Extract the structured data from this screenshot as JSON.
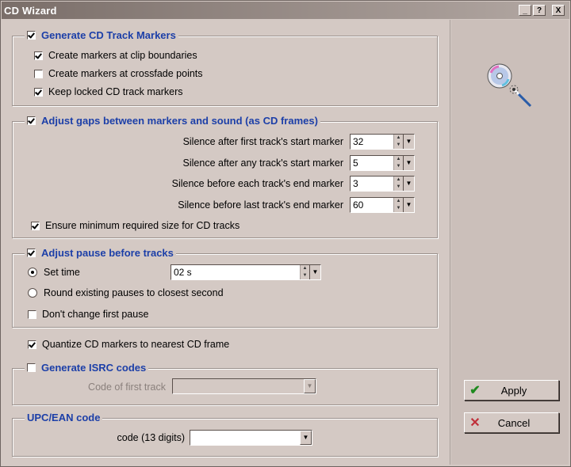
{
  "window": {
    "title": "CD Wizard",
    "controls": {
      "minimize": "_",
      "help": "?",
      "close": "X"
    }
  },
  "markers": {
    "title": "Generate CD Track Markers",
    "checked": true,
    "options": [
      {
        "label": "Create markers at clip boundaries",
        "checked": true
      },
      {
        "label": "Create markers at crossfade points",
        "checked": false
      },
      {
        "label": "Keep locked CD track markers",
        "checked": true
      }
    ]
  },
  "gaps": {
    "title": "Adjust gaps between markers and sound (as CD frames)",
    "checked": true,
    "fields": [
      {
        "label": "Silence after first track's start marker",
        "value": "32"
      },
      {
        "label": "Silence after any track's start marker",
        "value": "5"
      },
      {
        "label": "Silence before each track's end marker",
        "value": "3"
      },
      {
        "label": "Silence before last track's end marker",
        "value": "60"
      }
    ],
    "ensure": {
      "label": "Ensure minimum required size for CD tracks",
      "checked": true
    }
  },
  "pause": {
    "title": "Adjust pause before tracks",
    "checked": true,
    "set_time": {
      "label": "Set time",
      "value": "02 s",
      "selected": true
    },
    "round": {
      "label": "Round existing pauses to closest second",
      "selected": false
    },
    "first_pause": {
      "label": "Don't change first pause",
      "checked": false
    }
  },
  "quantize": {
    "label": "Quantize CD markers to nearest CD frame",
    "checked": true
  },
  "isrc": {
    "title": "Generate ISRC codes",
    "checked": false,
    "first_track_label": "Code of first track",
    "first_track_value": ""
  },
  "upc": {
    "title": "UPC/EAN code",
    "code_label": "code (13 digits)",
    "code_value": ""
  },
  "buttons": {
    "apply": "Apply",
    "cancel": "Cancel"
  },
  "icons": {
    "wizard": "cd-wand-icon",
    "apply": "checkmark-icon",
    "cancel": "x-icon"
  },
  "colors": {
    "title_blue": "#1c3fa8",
    "apply_green": "#1f8a1f",
    "cancel_red": "#c0303a"
  }
}
